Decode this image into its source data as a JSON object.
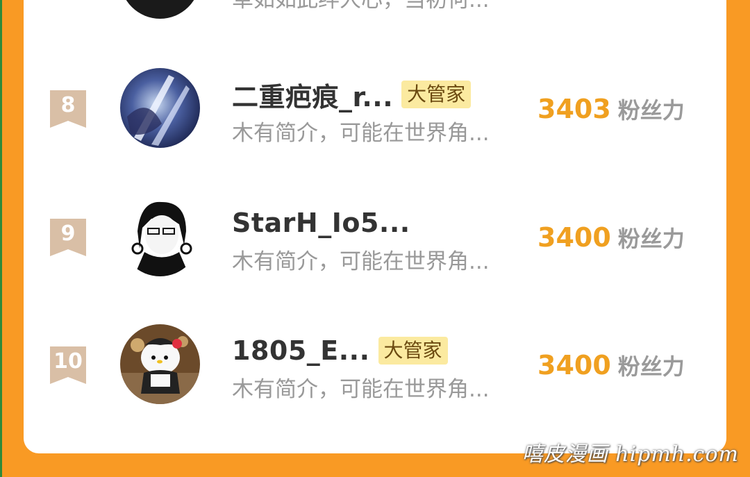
{
  "top_partial": {
    "desc": "草如如此绊人心，当初何..."
  },
  "rows": [
    {
      "rank": "8",
      "name": "二重疤痕_r...",
      "badge": "大管家",
      "desc": "木有简介，可能在世界角...",
      "score": "3403",
      "score_unit": "粉丝力"
    },
    {
      "rank": "9",
      "name": "StarH_Io5...",
      "badge": "",
      "desc": "木有简介，可能在世界角...",
      "score": "3400",
      "score_unit": "粉丝力"
    },
    {
      "rank": "10",
      "name": "1805_E...",
      "badge": "大管家",
      "desc": "木有简介，可能在世界角...",
      "score": "3400",
      "score_unit": "粉丝力"
    }
  ],
  "watermark": "嘻皮漫画 hipmh.com",
  "colors": {
    "background": "#f99a24",
    "score": "#f0a020",
    "badge_bg": "#fbeaa0",
    "rank_ribbon": "#d9bfa6"
  }
}
